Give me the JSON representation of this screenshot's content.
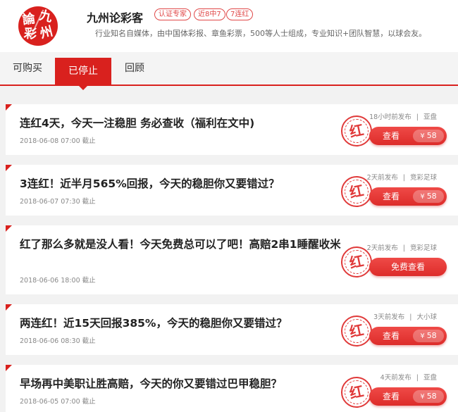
{
  "account": {
    "logo_chars": [
      "論",
      "九",
      "彩",
      "州"
    ],
    "name": "九州论彩客",
    "badges": [
      "认证专家",
      "近8中7",
      "7连红"
    ],
    "description": "行业知名自媒体，由中国体彩报、章鱼彩票，500等人士组成，专业知识+团队智慧，以球会友。"
  },
  "tabs": [
    {
      "label": "可购买",
      "active": false
    },
    {
      "label": "已停止",
      "active": true
    },
    {
      "label": "回顾",
      "active": false
    }
  ],
  "stamp_text": "红",
  "view_label": "查看",
  "currency_symbol": "¥",
  "posts": [
    {
      "title": "连红4天，今天一注稳胆 务必查收（福利在文中)",
      "date": "2018-06-08",
      "time": "07:00",
      "status": "截止",
      "published": "18小时前发布",
      "category": "亚盘",
      "price": "58",
      "free": false
    },
    {
      "title": "3连红！近半月565%回报，今天的稳胆你又要错过？",
      "date": "2018-06-07",
      "time": "07:30",
      "status": "截止",
      "published": "2天前发布",
      "category": "竞彩足球",
      "price": "58",
      "free": false
    },
    {
      "title": "红了那么多就是没人看！今天免费总可以了吧！高赔2串1睡醒收米",
      "date": "2018-06-06",
      "time": "18:00",
      "status": "截止",
      "published": "2天前发布",
      "category": "竞彩足球",
      "free": true,
      "free_label": "免费查看"
    },
    {
      "title": "两连红！近15天回报385%，今天的稳胆你又要错过？",
      "date": "2018-06-06",
      "time": "08:30",
      "status": "截止",
      "published": "3天前发布",
      "category": "大小球",
      "price": "58",
      "free": false
    },
    {
      "title": "早场再中美职让胜高赔，今天的你又要错过巴甲稳胆？",
      "date": "2018-06-05",
      "time": "07:00",
      "status": "截止",
      "published": "4天前发布",
      "category": "亚盘",
      "price": "58",
      "free": false
    }
  ],
  "colors": {
    "accent": "#d9211e",
    "text": "#222222",
    "muted": "#888888",
    "background": "#f2f2f2"
  }
}
